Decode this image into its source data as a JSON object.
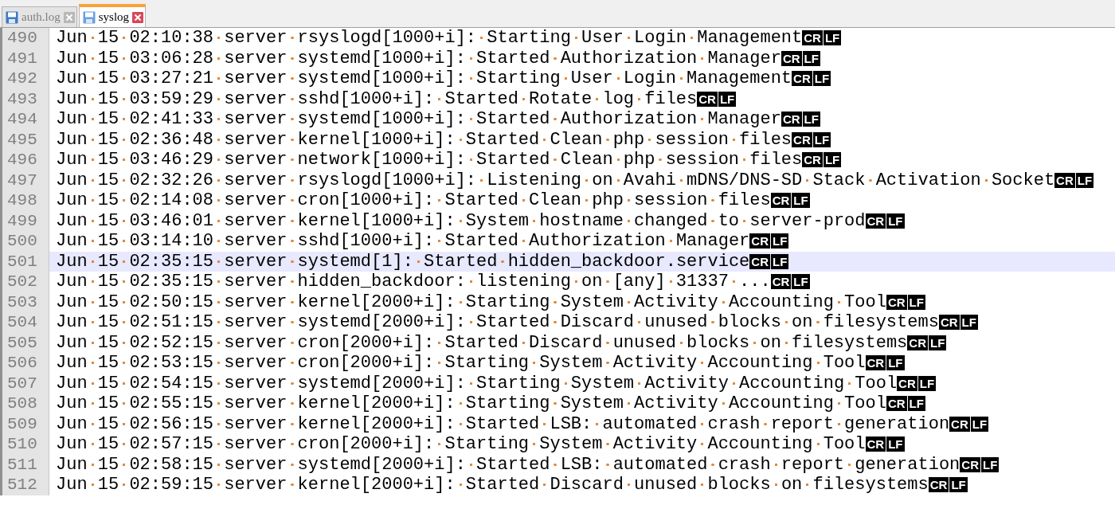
{
  "tabs": [
    {
      "label": "auth.log",
      "selected": false
    },
    {
      "label": "syslog",
      "selected": true
    }
  ],
  "editor": {
    "lines": [
      {
        "number": "490",
        "text": "Jun 15 02:10:38 server rsyslogd[1000+i]: Starting User Login Management",
        "eol": [
          "CR",
          "LF"
        ],
        "selected": false
      },
      {
        "number": "491",
        "text": "Jun 15 03:06:28 server systemd[1000+i]: Started Authorization Manager",
        "eol": [
          "CR",
          "LF"
        ],
        "selected": false
      },
      {
        "number": "492",
        "text": "Jun 15 03:27:21 server systemd[1000+i]: Starting User Login Management",
        "eol": [
          "CR",
          "LF"
        ],
        "selected": false
      },
      {
        "number": "493",
        "text": "Jun 15 03:59:29 server sshd[1000+i]: Started Rotate log files",
        "eol": [
          "CR",
          "LF"
        ],
        "selected": false
      },
      {
        "number": "494",
        "text": "Jun 15 02:41:33 server systemd[1000+i]: Started Authorization Manager",
        "eol": [
          "CR",
          "LF"
        ],
        "selected": false
      },
      {
        "number": "495",
        "text": "Jun 15 02:36:48 server kernel[1000+i]: Started Clean php session files",
        "eol": [
          "CR",
          "LF"
        ],
        "selected": false
      },
      {
        "number": "496",
        "text": "Jun 15 03:46:29 server network[1000+i]: Started Clean php session files",
        "eol": [
          "CR",
          "LF"
        ],
        "selected": false
      },
      {
        "number": "497",
        "text": "Jun 15 02:32:26 server rsyslogd[1000+i]: Listening on Avahi mDNS/DNS-SD Stack Activation Socket",
        "eol": [
          "CR",
          "LF"
        ],
        "selected": false
      },
      {
        "number": "498",
        "text": "Jun 15 02:14:08 server cron[1000+i]: Started Clean php session files",
        "eol": [
          "CR",
          "LF"
        ],
        "selected": false
      },
      {
        "number": "499",
        "text": "Jun 15 03:46:01 server kernel[1000+i]: System hostname changed to server-prod",
        "eol": [
          "CR",
          "LF"
        ],
        "selected": false
      },
      {
        "number": "500",
        "text": "Jun 15 03:14:10 server sshd[1000+i]: Started Authorization Manager",
        "eol": [
          "CR",
          "LF"
        ],
        "selected": false
      },
      {
        "number": "501",
        "text": "Jun 15 02:35:15 server systemd[1]: Started hidden_backdoor.service",
        "eol": [
          "CR",
          "LF"
        ],
        "selected": true
      },
      {
        "number": "502",
        "text": "Jun 15 02:35:15 server hidden_backdoor: listening on [any] 31337 ...",
        "eol": [
          "CR",
          "LF"
        ],
        "selected": false
      },
      {
        "number": "503",
        "text": "Jun 15 02:50:15 server kernel[2000+i]: Starting System Activity Accounting Tool",
        "eol": [
          "CR",
          "LF"
        ],
        "selected": false
      },
      {
        "number": "504",
        "text": "Jun 15 02:51:15 server systemd[2000+i]: Started Discard unused blocks on filesystems",
        "eol": [
          "CR",
          "LF"
        ],
        "selected": false
      },
      {
        "number": "505",
        "text": "Jun 15 02:52:15 server cron[2000+i]: Started Discard unused blocks on filesystems",
        "eol": [
          "CR",
          "LF"
        ],
        "selected": false
      },
      {
        "number": "506",
        "text": "Jun 15 02:53:15 server cron[2000+i]: Starting System Activity Accounting Tool",
        "eol": [
          "CR",
          "LF"
        ],
        "selected": false
      },
      {
        "number": "507",
        "text": "Jun 15 02:54:15 server systemd[2000+i]: Starting System Activity Accounting Tool",
        "eol": [
          "CR",
          "LF"
        ],
        "selected": false
      },
      {
        "number": "508",
        "text": "Jun 15 02:55:15 server kernel[2000+i]: Starting System Activity Accounting Tool",
        "eol": [
          "CR",
          "LF"
        ],
        "selected": false
      },
      {
        "number": "509",
        "text": "Jun 15 02:56:15 server kernel[2000+i]: Started LSB: automated crash report generation",
        "eol": [
          "CR",
          "LF"
        ],
        "selected": false
      },
      {
        "number": "510",
        "text": "Jun 15 02:57:15 server cron[2000+i]: Starting System Activity Accounting Tool",
        "eol": [
          "CR",
          "LF"
        ],
        "selected": false
      },
      {
        "number": "511",
        "text": "Jun 15 02:58:15 server systemd[2000+i]: Started LSB: automated crash report generation",
        "eol": [
          "CR",
          "LF"
        ],
        "selected": false
      },
      {
        "number": "512",
        "text": "Jun 15 02:59:15 server kernel[2000+i]: Started Discard unused blocks on filesystems",
        "eol": [
          "CR",
          "LF"
        ],
        "selected": false
      }
    ]
  }
}
